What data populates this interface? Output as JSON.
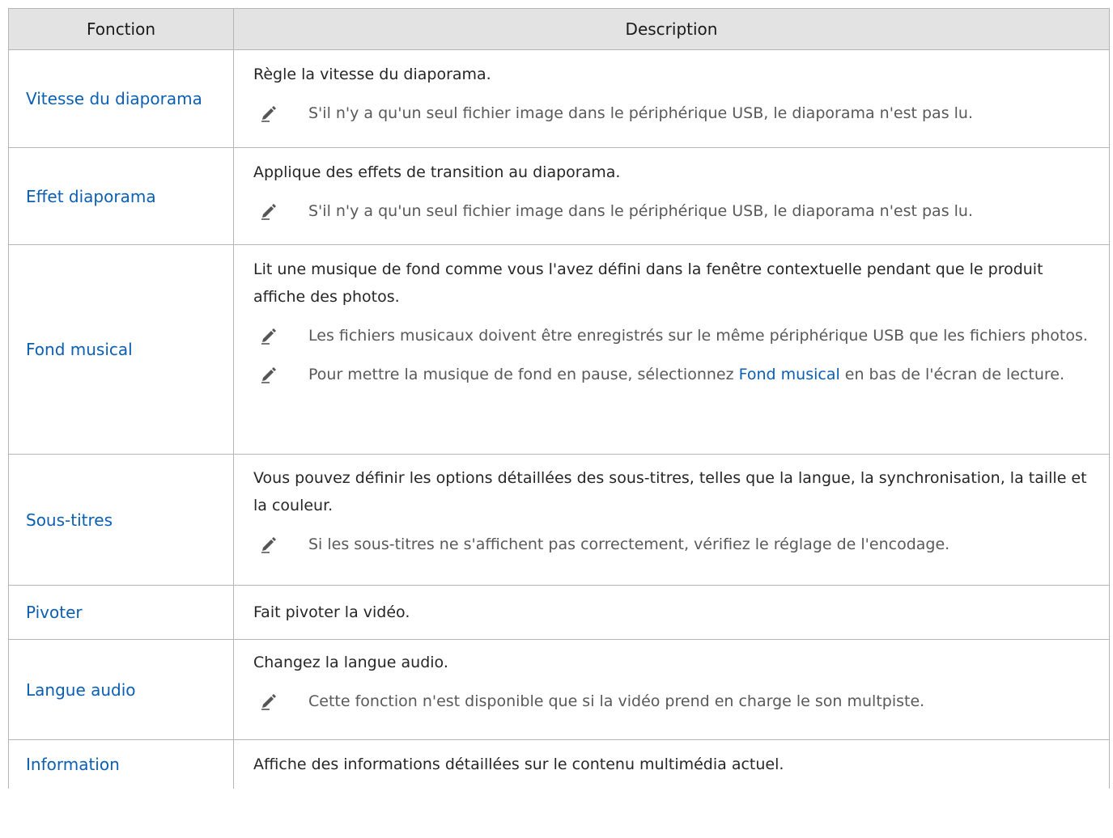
{
  "header": {
    "col1": "Fonction",
    "col2": "Description"
  },
  "rows": [
    {
      "name": "Vitesse du diaporama",
      "desc": "Règle la vitesse du diaporama.",
      "notes": [
        "S'il n'y a qu'un seul fichier image dans le périphérique USB, le diaporama n'est pas lu."
      ]
    },
    {
      "name": "Effet diaporama",
      "desc": "Applique des effets de transition au diaporama.",
      "notes": [
        "S'il n'y a qu'un seul fichier image dans le périphérique USB, le diaporama n'est pas lu."
      ]
    },
    {
      "name": "Fond musical",
      "desc": "Lit une musique de fond comme vous l'avez défini dans la fenêtre contextuelle pendant que le produit affiche des photos.",
      "notes": [
        "Les fichiers musicaux doivent être enregistrés sur le même périphérique USB que les fichiers photos."
      ],
      "note2": {
        "before": "Pour mettre la musique de fond en pause, sélectionnez ",
        "link": "Fond musical",
        "after": " en bas de l'écran de lecture."
      }
    },
    {
      "name": "Sous-titres",
      "desc": "Vous pouvez définir les options détaillées des sous-titres, telles que la langue, la synchronisation, la taille et la couleur.",
      "notes": [
        "Si les sous-titres ne s'affichent pas correctement, vérifiez le réglage de l'encodage."
      ]
    },
    {
      "name": "Pivoter",
      "desc": "Fait pivoter la vidéo.",
      "notes": []
    },
    {
      "name": "Langue audio",
      "desc": "Changez la langue audio.",
      "notes": [
        "Cette fonction n'est disponible que si la vidéo prend en charge le son multpiste."
      ]
    },
    {
      "name": "Information",
      "desc": "Affiche des informations détaillées sur le contenu multimédia actuel.",
      "notes": []
    }
  ],
  "icons": {
    "note": "pencil-icon"
  },
  "colors": {
    "function_name": "#0b5fb3",
    "header_bg": "#e3e3e3",
    "note_text": "#595959"
  }
}
